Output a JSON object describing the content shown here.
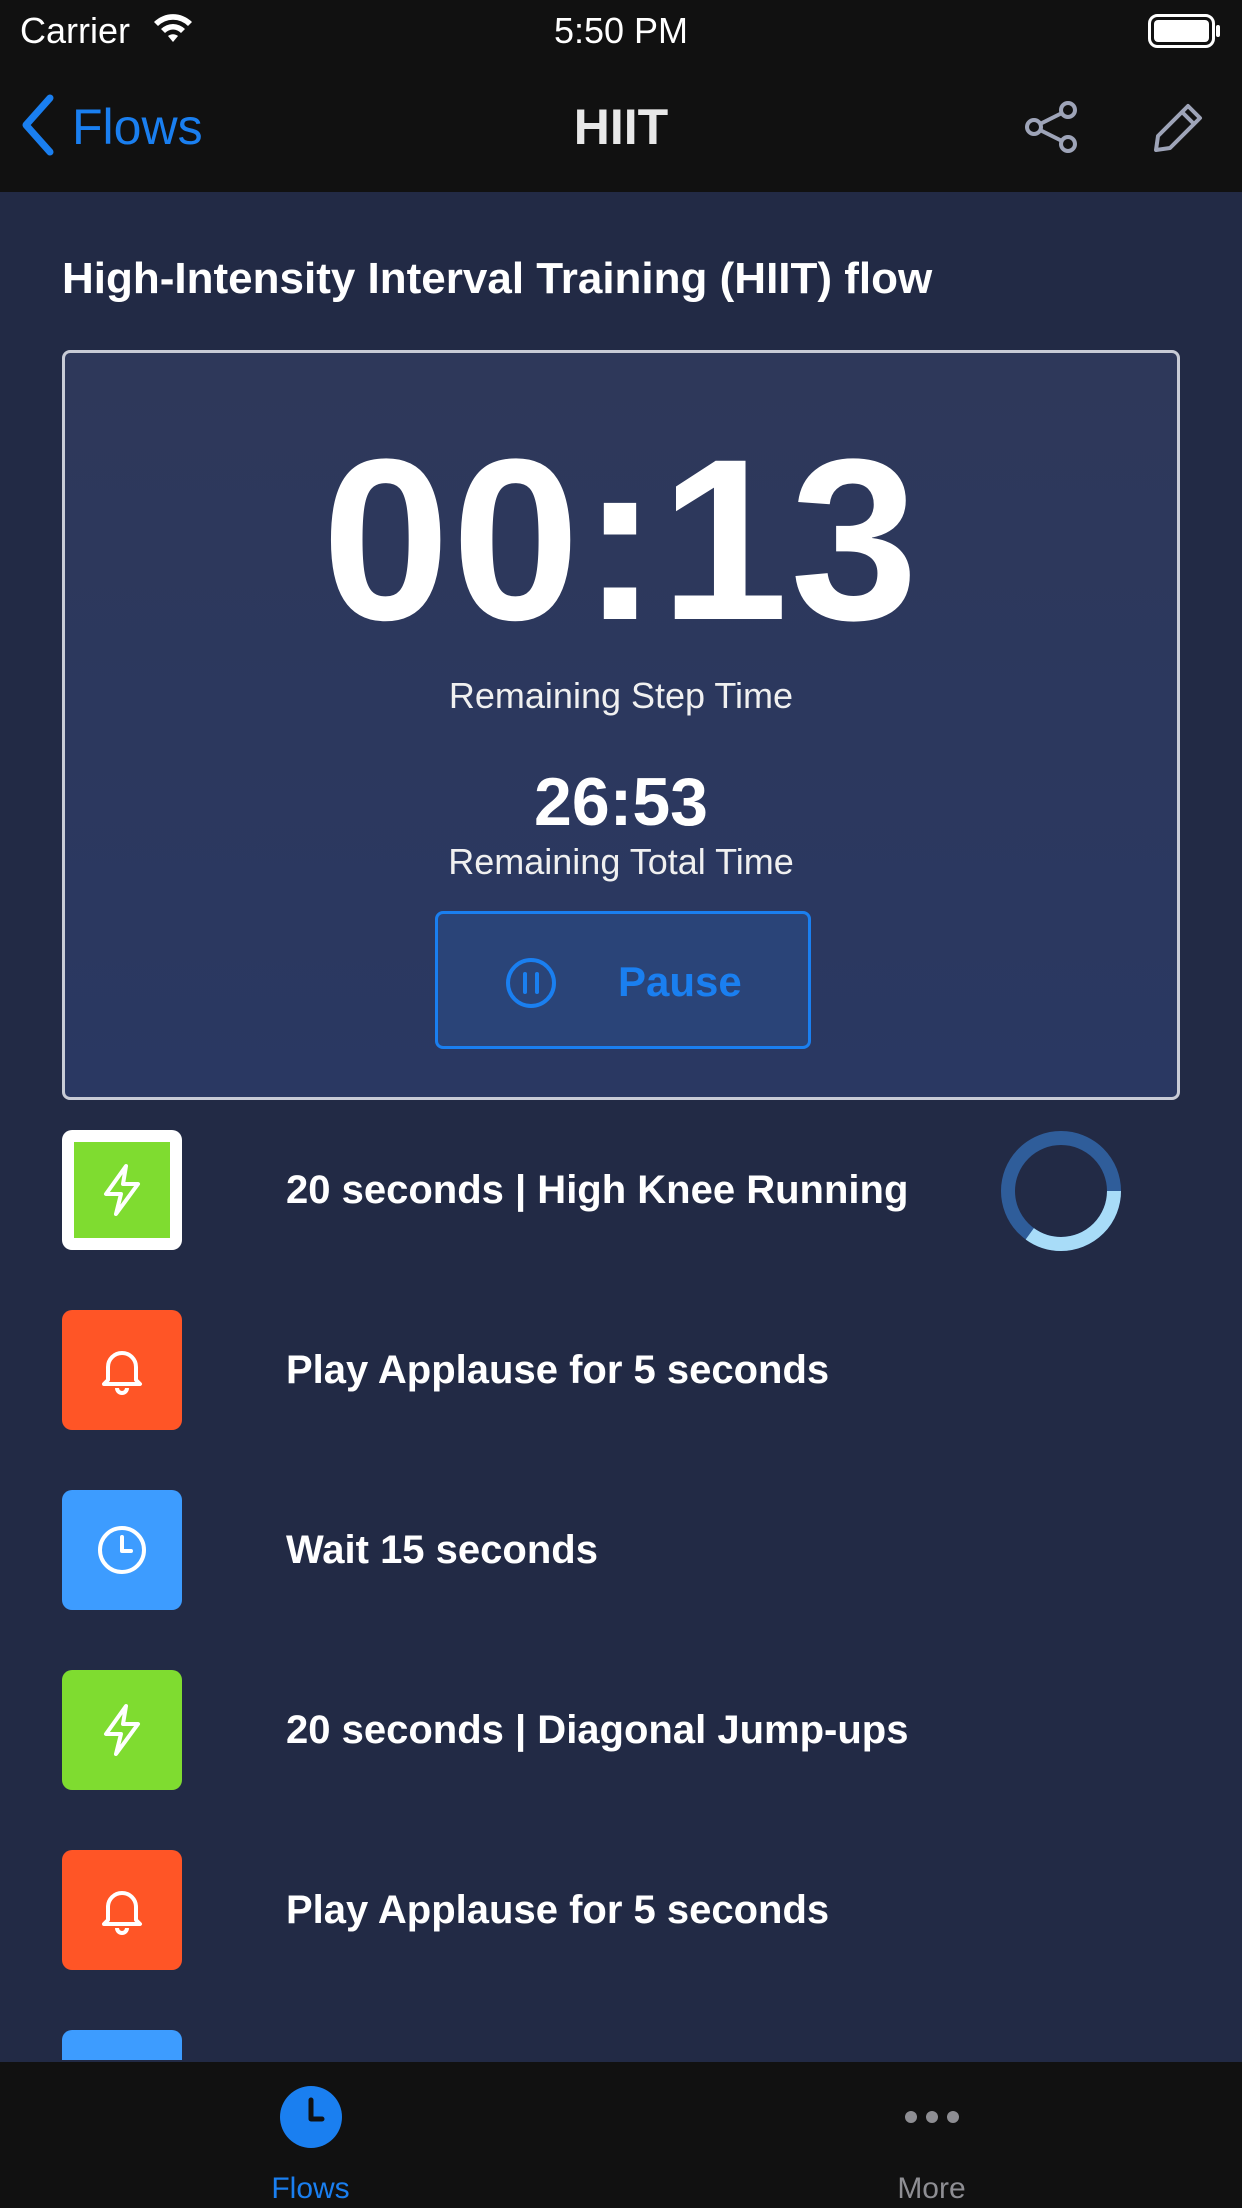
{
  "status_bar": {
    "carrier": "Carrier",
    "time": "5:50 PM"
  },
  "nav": {
    "back_label": "Flows",
    "title": "HIIT",
    "accent": "#1a7ff0"
  },
  "flow": {
    "heading": "High-Intensity Interval Training (HIIT) flow"
  },
  "timer": {
    "step_time": "00:13",
    "step_time_label": "Remaining Step Time",
    "total_time": "26:53",
    "total_time_label": "Remaining Total Time",
    "pause_label": "Pause",
    "step_progress_fraction": 0.35
  },
  "steps": [
    {
      "label": "20 seconds | High Knee Running",
      "icon": "bolt-icon",
      "color": "#7fdc30",
      "active": true
    },
    {
      "label": "Play Applause for 5 seconds",
      "icon": "bell-icon",
      "color": "#ff5526",
      "active": false
    },
    {
      "label": "Wait 15 seconds",
      "icon": "clock-icon",
      "color": "#3d9cff",
      "active": false
    },
    {
      "label": "20 seconds | Diagonal Jump-ups",
      "icon": "bolt-icon",
      "color": "#7fdc30",
      "active": false
    },
    {
      "label": "Play Applause for 5 seconds",
      "icon": "bell-icon",
      "color": "#ff5526",
      "active": false
    }
  ],
  "tabs": {
    "flows_label": "Flows",
    "more_label": "More",
    "active_color": "#1a7ff0",
    "inactive_color": "#8e8e93"
  }
}
